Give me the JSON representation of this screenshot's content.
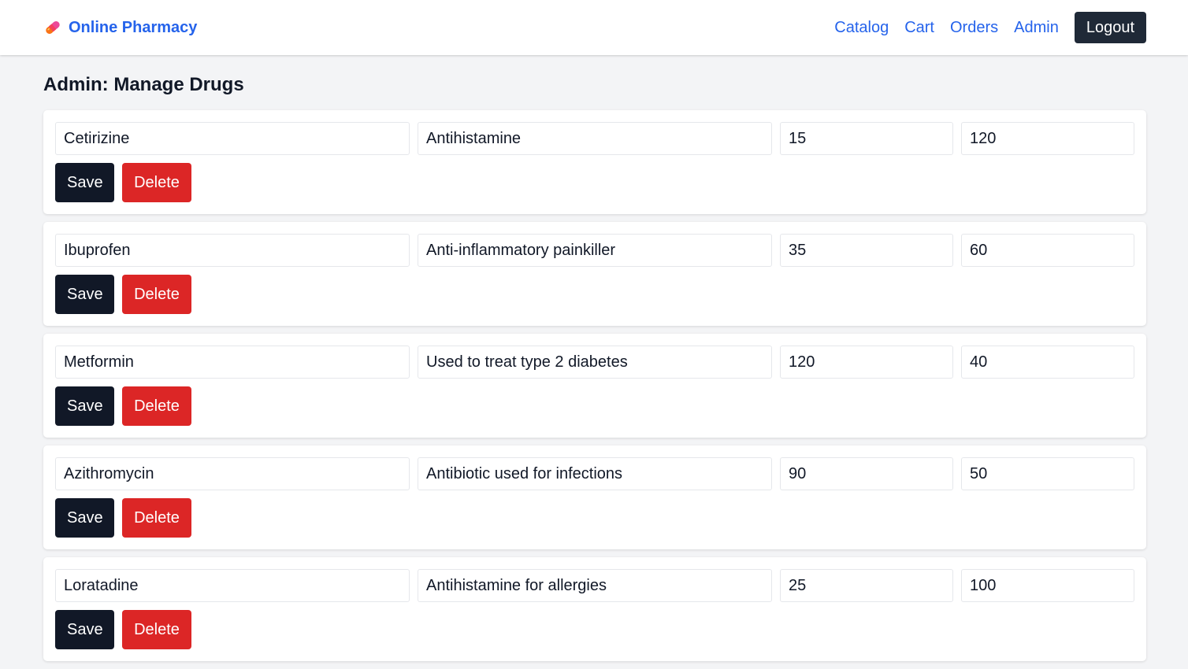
{
  "app": {
    "brand": "Online Pharmacy",
    "brand_icon": "pill-icon",
    "colors": {
      "accent": "#2563eb",
      "dark": "#111827",
      "danger": "#dc2626",
      "background": "#f3f4f6"
    }
  },
  "nav": {
    "links": [
      "Catalog",
      "Cart",
      "Orders",
      "Admin"
    ],
    "logout_label": "Logout"
  },
  "page": {
    "title": "Admin: Manage Drugs"
  },
  "actions": {
    "save_label": "Save",
    "delete_label": "Delete"
  },
  "drugs": [
    {
      "name": "Cetirizine",
      "description": "Antihistamine",
      "price": "15",
      "stock": "120"
    },
    {
      "name": "Ibuprofen",
      "description": "Anti-inflammatory painkiller",
      "price": "35",
      "stock": "60"
    },
    {
      "name": "Metformin",
      "description": "Used to treat type 2 diabetes",
      "price": "120",
      "stock": "40"
    },
    {
      "name": "Azithromycin",
      "description": "Antibiotic used for infections",
      "price": "90",
      "stock": "50"
    },
    {
      "name": "Loratadine",
      "description": "Antihistamine for allergies",
      "price": "25",
      "stock": "100"
    }
  ]
}
